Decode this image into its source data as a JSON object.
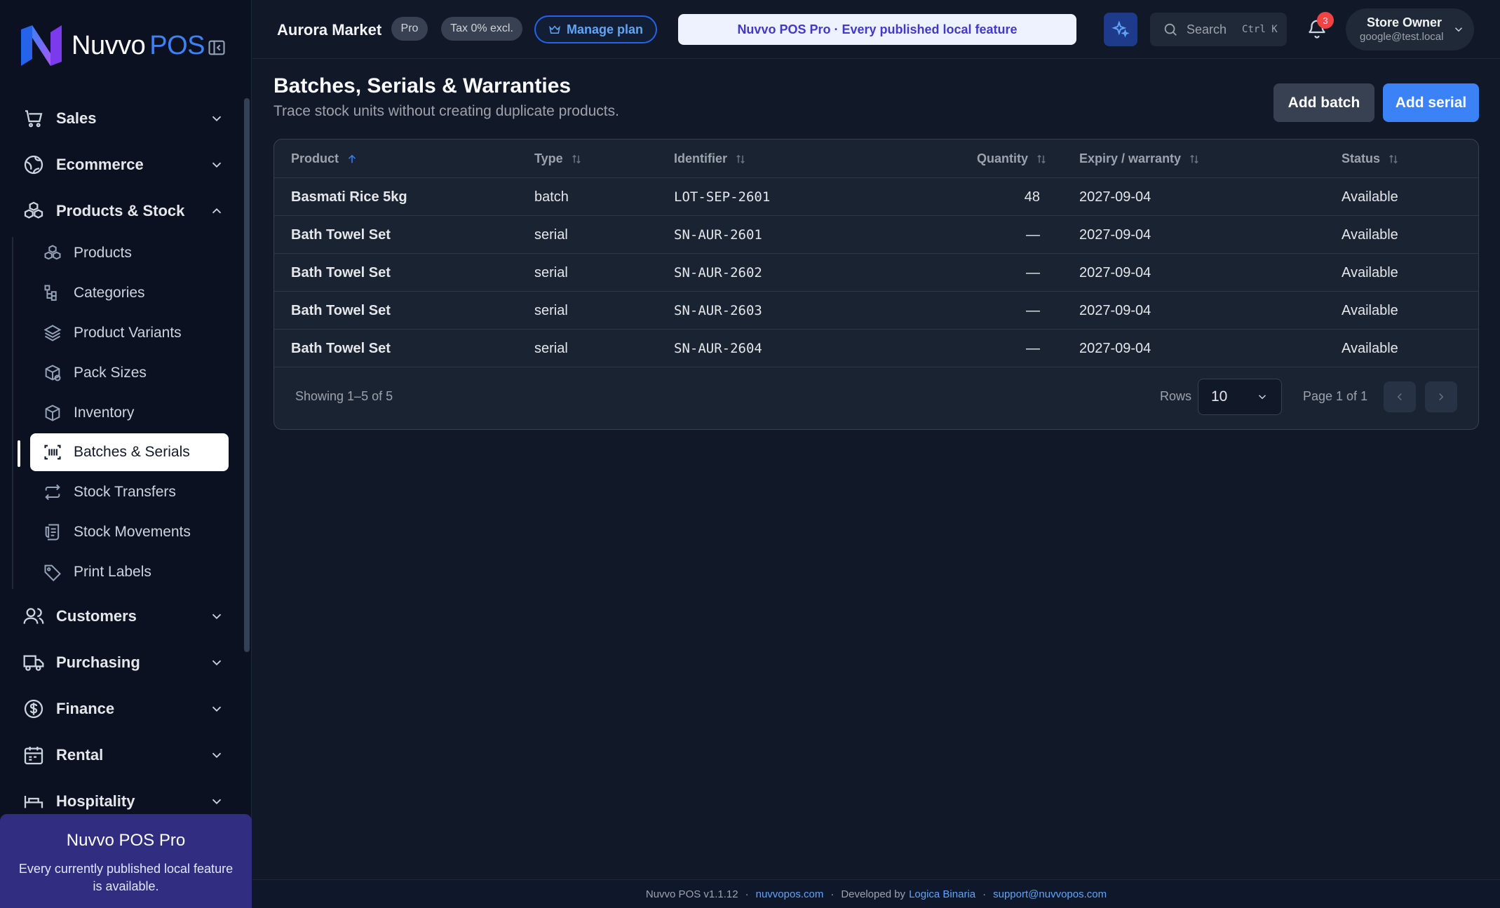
{
  "brand": {
    "name": "Nuvvo",
    "suffix": "POS"
  },
  "sidebar": {
    "groups": [
      {
        "label": "Sales",
        "icon": "cart-icon"
      },
      {
        "label": "Ecommerce",
        "icon": "globe-icon"
      },
      {
        "label": "Products & Stock",
        "icon": "boxes-icon",
        "expanded": true
      },
      {
        "label": "Customers",
        "icon": "users-icon"
      },
      {
        "label": "Purchasing",
        "icon": "truck-icon"
      },
      {
        "label": "Finance",
        "icon": "dollar-icon"
      },
      {
        "label": "Rental",
        "icon": "calendar-icon"
      },
      {
        "label": "Hospitality",
        "icon": "bed-icon"
      }
    ],
    "products_stock_items": [
      {
        "label": "Products",
        "icon": "boxes-icon"
      },
      {
        "label": "Categories",
        "icon": "tree-icon"
      },
      {
        "label": "Product Variants",
        "icon": "layers-icon"
      },
      {
        "label": "Pack Sizes",
        "icon": "package-icon"
      },
      {
        "label": "Inventory",
        "icon": "box-icon"
      },
      {
        "label": "Batches & Serials",
        "icon": "barcode-icon",
        "active": true
      },
      {
        "label": "Stock Transfers",
        "icon": "transfer-icon"
      },
      {
        "label": "Stock Movements",
        "icon": "scroll-icon"
      },
      {
        "label": "Print Labels",
        "icon": "tag-icon"
      }
    ],
    "promo": {
      "title": "Nuvvo POS Pro",
      "description": "Every currently published local feature is available."
    }
  },
  "topbar": {
    "store_name": "Aurora Market",
    "plan_badge": "Pro",
    "tax_badge": "Tax 0% excl.",
    "manage_plan": "Manage plan",
    "banner": "Nuvvo POS Pro · Every published local feature",
    "search_placeholder": "Search",
    "search_shortcut": "Ctrl K",
    "notifications_count": "3",
    "user_name": "Store Owner",
    "user_email": "google@test.local"
  },
  "page": {
    "title": "Batches, Serials & Warranties",
    "subtitle": "Trace stock units without creating duplicate products.",
    "add_batch": "Add batch",
    "add_serial": "Add serial"
  },
  "table": {
    "columns": [
      "Product",
      "Type",
      "Identifier",
      "Quantity",
      "Expiry / warranty",
      "Status"
    ],
    "rows": [
      {
        "product": "Basmati Rice 5kg",
        "type": "batch",
        "identifier": "LOT-SEP-2601",
        "quantity": "48",
        "expiry": "2027-09-04",
        "status": "Available"
      },
      {
        "product": "Bath Towel Set",
        "type": "serial",
        "identifier": "SN-AUR-2601",
        "quantity": "—",
        "expiry": "2027-09-04",
        "status": "Available"
      },
      {
        "product": "Bath Towel Set",
        "type": "serial",
        "identifier": "SN-AUR-2602",
        "quantity": "—",
        "expiry": "2027-09-04",
        "status": "Available"
      },
      {
        "product": "Bath Towel Set",
        "type": "serial",
        "identifier": "SN-AUR-2603",
        "quantity": "—",
        "expiry": "2027-09-04",
        "status": "Available"
      },
      {
        "product": "Bath Towel Set",
        "type": "serial",
        "identifier": "SN-AUR-2604",
        "quantity": "—",
        "expiry": "2027-09-04",
        "status": "Available"
      }
    ],
    "showing": "Showing 1–5 of 5",
    "rows_label": "Rows",
    "rows_value": "10",
    "page_info": "Page 1 of 1"
  },
  "footer": {
    "version": "Nuvvo POS v1.1.12",
    "site": "nuvvopos.com",
    "developed_by": "Developed by",
    "developer": "Logica Binaria",
    "support": "support@nuvvopos.com"
  },
  "colors": {
    "accent": "#3b82f6",
    "background": "#111827",
    "sidebar": "#0b1120",
    "promo": "#312e81",
    "badge": "#ef4444"
  }
}
